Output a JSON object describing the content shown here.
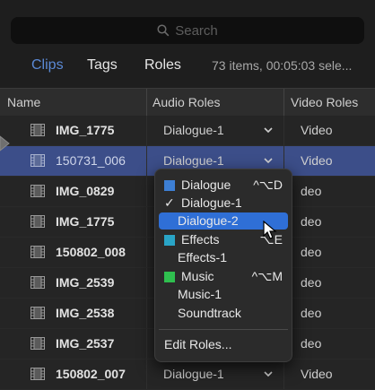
{
  "search": {
    "placeholder": "Search"
  },
  "tabs": [
    {
      "label": "Clips",
      "active": true
    },
    {
      "label": "Tags",
      "active": false
    },
    {
      "label": "Roles",
      "active": false
    }
  ],
  "summary": "73 items, 00:05:03 sele...",
  "columns": {
    "name": "Name",
    "audio": "Audio Roles",
    "video": "Video Roles"
  },
  "rows": [
    {
      "name": "IMG_1775",
      "audio": "Dialogue-1",
      "video": "Video",
      "selected": false
    },
    {
      "name": "150731_006",
      "audio": "Dialogue-1",
      "video": "Video",
      "selected": true
    },
    {
      "name": "IMG_0829",
      "audio": "",
      "video": "deo",
      "selected": false
    },
    {
      "name": "IMG_1775",
      "audio": "",
      "video": "deo",
      "selected": false
    },
    {
      "name": "150802_008",
      "audio": "",
      "video": "deo",
      "selected": false
    },
    {
      "name": "IMG_2539",
      "audio": "",
      "video": "deo",
      "selected": false
    },
    {
      "name": "IMG_2538",
      "audio": "",
      "video": "deo",
      "selected": false
    },
    {
      "name": "IMG_2537",
      "audio": "",
      "video": "deo",
      "selected": false
    },
    {
      "name": "150802_007",
      "audio": "Dialogue-1",
      "video": "Video",
      "selected": false
    }
  ],
  "menu": {
    "items": [
      {
        "label": "Dialogue",
        "shortcut": "^⌥D",
        "swatch": "#3d7fd4",
        "type": "role"
      },
      {
        "label": "Dialogue-1",
        "checked": true,
        "type": "subrole"
      },
      {
        "label": "Dialogue-2",
        "highlighted": true,
        "type": "subrole"
      },
      {
        "label": "Effects",
        "shortcut": "⌥E",
        "swatch": "#29a4c6",
        "type": "role"
      },
      {
        "label": "Effects-1",
        "type": "subrole"
      },
      {
        "label": "Music",
        "shortcut": "^⌥M",
        "swatch": "#2fbf4f",
        "type": "role"
      },
      {
        "label": "Music-1",
        "type": "subrole"
      },
      {
        "label": "Soundtrack",
        "type": "subrole"
      }
    ],
    "edit_label": "Edit Roles..."
  },
  "colors": {
    "accent": "#5b8ad6",
    "selected_row": "#3c4e89",
    "menu_highlight": "#2f6fd6"
  }
}
